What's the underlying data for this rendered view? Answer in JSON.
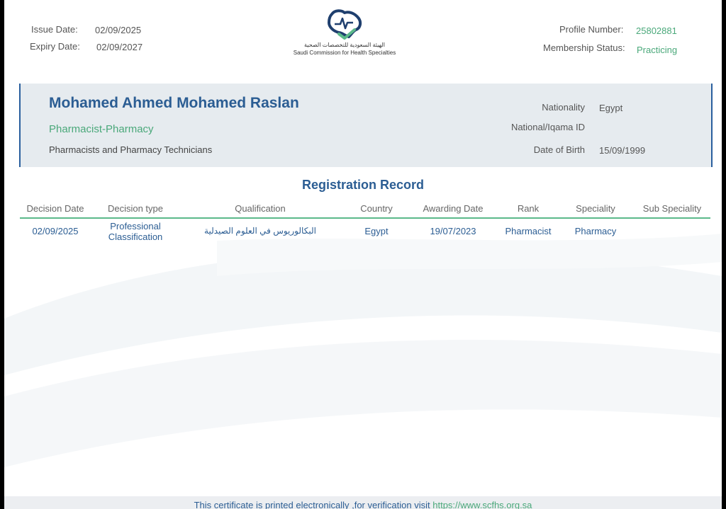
{
  "header": {
    "issue_label": "Issue Date:",
    "issue_value": "02/09/2025",
    "expiry_label": "Expiry Date:",
    "expiry_value": "02/09/2027",
    "profile_label": "Profile Number:",
    "profile_value": "25802881",
    "membership_label": "Membership Status:",
    "membership_value": "Practicing"
  },
  "logo": {
    "arabic": "الهيئة السعودية للتخصصات الصحية",
    "english": "Saudi Commission for Health Specialties"
  },
  "profile": {
    "name": "Mohamed Ahmed Mohamed Raslan",
    "title": "Pharmacist-Pharmacy",
    "category": "Pharmacists and Pharmacy Technicians",
    "nationality_label": "Nationality",
    "nationality_value": "Egypt",
    "id_label": "National/Iqama ID",
    "id_value": "",
    "dob_label": "Date of Birth",
    "dob_value": "15/09/1999"
  },
  "registration": {
    "title": "Registration Record",
    "columns": [
      "Decision Date",
      "Decision type",
      "Qualification",
      "Country",
      "Awarding Date",
      "Rank",
      "Speciality",
      "Sub Speciality"
    ],
    "rows": [
      {
        "decision_date": "02/09/2025",
        "decision_type_line1": "Professional",
        "decision_type_line2": "Classification",
        "qualification": "البكالوريوس في العلوم الصيدلية",
        "country": "Egypt",
        "awarding_date": "19/07/2023",
        "rank": "Pharmacist",
        "speciality": "Pharmacy",
        "sub_speciality": ""
      }
    ]
  },
  "footer": {
    "text": "This certificate is printed electronically ,for verification visit",
    "link": "https://www.scfhs.org.sa"
  },
  "colors": {
    "primary_blue": "#2b5d93",
    "accent_green": "#4aa87a",
    "panel_bg": "#e6ebef"
  }
}
